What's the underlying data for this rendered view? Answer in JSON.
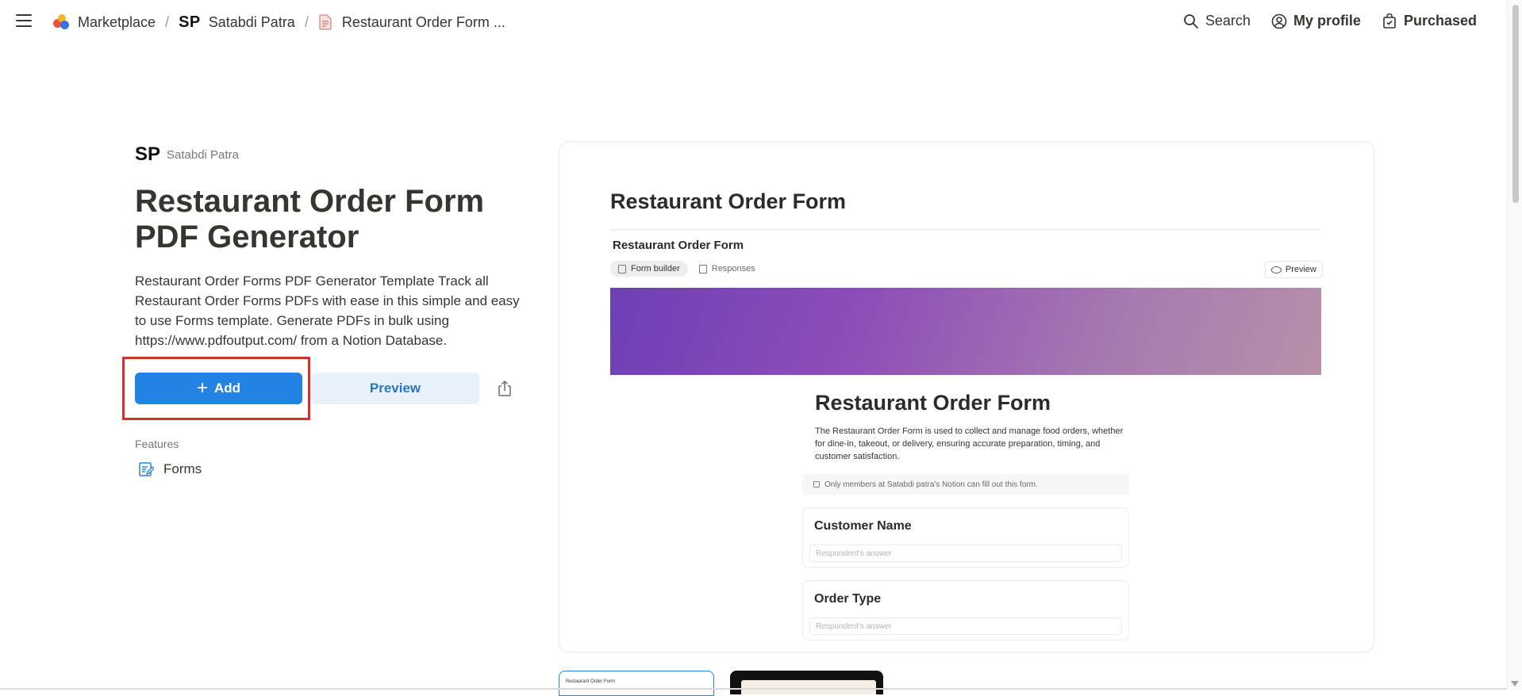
{
  "breadcrumbs": {
    "marketplace": "Marketplace",
    "creator_mark": "SP",
    "creator_name": "Satabdi Patra",
    "page": "Restaurant Order Form ..."
  },
  "nav": {
    "search": "Search",
    "profile": "My profile",
    "purchased": "Purchased"
  },
  "template": {
    "creator_mark": "SP",
    "creator_name": "Satabdi Patra",
    "title": "Restaurant Order Form PDF Generator",
    "description": "Restaurant Order Forms PDF Generator Template Track all Restaurant Order Forms PDFs with ease in this simple and easy to use Forms template. Generate PDFs in bulk using https://www.pdfoutput.com/ from a Notion Database.",
    "add_label": "Add",
    "preview_label": "Preview",
    "features_label": "Features",
    "features": [
      "Forms"
    ]
  },
  "preview": {
    "page_title": "Restaurant Order Form",
    "db_title": "Restaurant Order Form",
    "tab_builder": "Form builder",
    "tab_responses": "Responses",
    "preview_button": "Preview",
    "form_title": "Restaurant Order Form",
    "form_description": "The Restaurant Order Form is used to collect and manage food orders, whether for dine-in, takeout, or delivery, ensuring accurate preparation, timing, and customer satisfaction.",
    "notice": "Only members at Satabdi patra's Notion can fill out this form.",
    "fields": [
      {
        "label": "Customer Name",
        "placeholder": "Respondent's answer"
      },
      {
        "label": "Order Type",
        "placeholder": "Respondent's answer"
      }
    ]
  },
  "thumbnails": {
    "first_label": "Restaurant Order Form"
  },
  "colors": {
    "accent": "#2383e2",
    "highlight": "#d3302f",
    "preview_bg": "#e8f2fb"
  }
}
